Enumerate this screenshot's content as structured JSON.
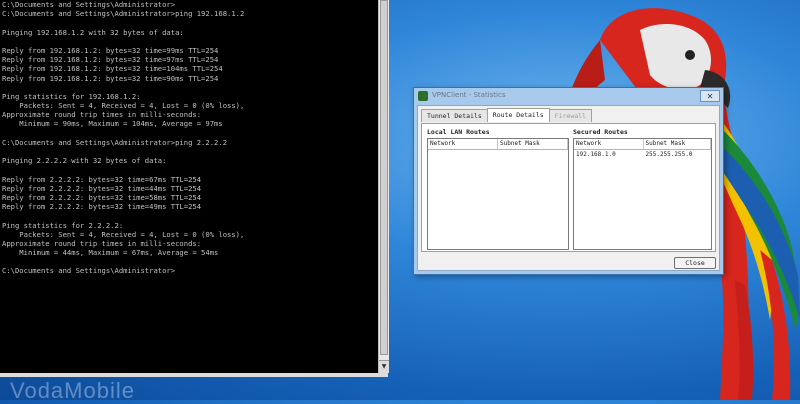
{
  "console": {
    "lines": [
      "C:\\Documents and Settings\\Administrator>",
      "C:\\Documents and Settings\\Administrator>ping 192.168.1.2",
      "",
      "Pinging 192.168.1.2 with 32 bytes of data:",
      "",
      "Reply from 192.168.1.2: bytes=32 time=99ms TTL=254",
      "Reply from 192.168.1.2: bytes=32 time=97ms TTL=254",
      "Reply from 192.168.1.2: bytes=32 time=104ms TTL=254",
      "Reply from 192.168.1.2: bytes=32 time=90ms TTL=254",
      "",
      "Ping statistics for 192.168.1.2:",
      "    Packets: Sent = 4, Received = 4, Lost = 0 (0% loss),",
      "Approximate round trip times in milli-seconds:",
      "    Minimum = 90ms, Maximum = 104ms, Average = 97ms",
      "",
      "C:\\Documents and Settings\\Administrator>ping 2.2.2.2",
      "",
      "Pinging 2.2.2.2 with 32 bytes of data:",
      "",
      "Reply from 2.2.2.2: bytes=32 time=67ms TTL=254",
      "Reply from 2.2.2.2: bytes=32 time=44ms TTL=254",
      "Reply from 2.2.2.2: bytes=32 time=58ms TTL=254",
      "Reply from 2.2.2.2: bytes=32 time=49ms TTL=254",
      "",
      "Ping statistics for 2.2.2.2:",
      "    Packets: Sent = 4, Received = 4, Lost = 0 (0% loss),",
      "Approximate round trip times in milli-seconds:",
      "    Minimum = 44ms, Maximum = 67ms, Average = 54ms",
      "",
      "C:\\Documents and Settings\\Administrator>"
    ]
  },
  "dialog": {
    "title": "VPNClient - Statistics",
    "close_glyph": "✕",
    "tabs": [
      {
        "label": "Tunnel Details"
      },
      {
        "label": "Route Details"
      },
      {
        "label": "Firewall"
      }
    ],
    "local_lan": {
      "label": "Local LAN Routes",
      "columns": [
        "Network",
        "Subnet Mask"
      ]
    },
    "secured": {
      "label": "Secured Routes",
      "columns": [
        "Network",
        "Subnet Mask"
      ],
      "rows": [
        [
          "192.168.1.0",
          "255.255.255.0"
        ]
      ]
    },
    "close_button": "Close"
  },
  "desktop": {
    "watermark": "VodaMobile"
  },
  "colors": {
    "console_bg": "#000000",
    "console_text": "#c0c0c0",
    "desktop_blue": "#2f86d9"
  }
}
